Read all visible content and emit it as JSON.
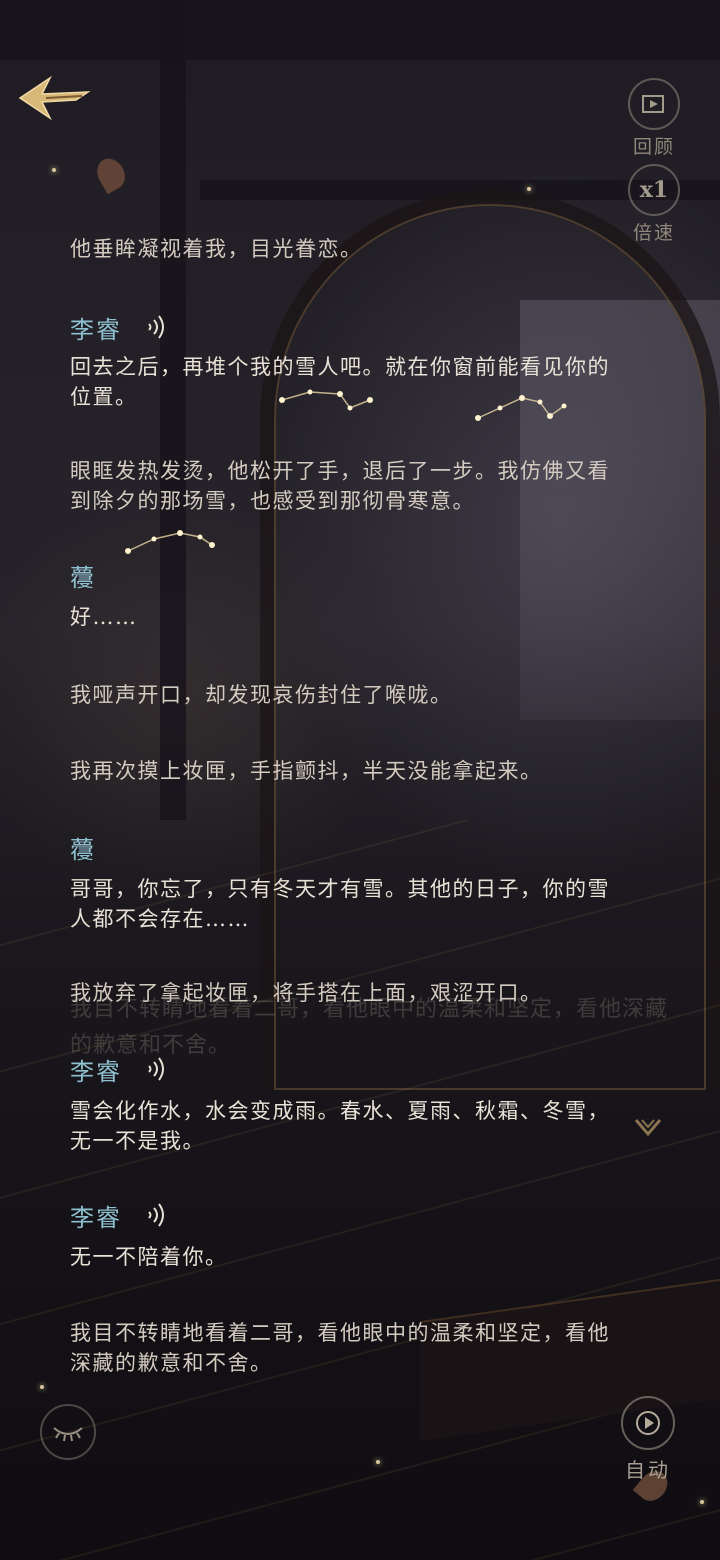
{
  "controls": {
    "back_icon": "back-arrow-icon",
    "review_label": "回顾",
    "speed_value": "x1",
    "speed_label": "倍速",
    "auto_label": "自动"
  },
  "dialogue": [
    {
      "type": "narration",
      "text": "他垂眸凝视着我，目光眷恋。"
    },
    {
      "type": "speech",
      "speaker": "李睿",
      "voice": true,
      "text": "回去之后，再堆个我的雪人吧。就在你窗前能看见你的位置。"
    },
    {
      "type": "narration",
      "text": "眼眶发热发烫，他松开了手，退后了一步。我仿佛又看到除夕的那场雪，也感受到那彻骨寒意。"
    },
    {
      "type": "speech",
      "speaker": "蘉",
      "voice": false,
      "text": "好……"
    },
    {
      "type": "narration",
      "text": "我哑声开口，却发现哀伤封住了喉咙。"
    },
    {
      "type": "narration",
      "text": "我再次摸上妆匣，手指颤抖，半天没能拿起来。"
    },
    {
      "type": "speech",
      "speaker": "蘉",
      "voice": false,
      "text": "哥哥，你忘了，只有冬天才有雪。其他的日子，你的雪人都不会存在……"
    },
    {
      "type": "narration",
      "text": "我放弃了拿起妆匣，将手搭在上面，艰涩开口。"
    },
    {
      "type": "speech",
      "speaker": "李睿",
      "voice": true,
      "text": "雪会化作水，水会变成雨。春水、夏雨、秋霜、冬雪，无一不是我。"
    },
    {
      "type": "speech",
      "speaker": "李睿",
      "voice": true,
      "text": "无一不陪着你。"
    },
    {
      "type": "narration",
      "text": "我目不转睛地看着二哥，看他眼中的温柔和坚定，看他深藏的歉意和不舍。"
    }
  ],
  "ghost_text": "我目不转睛地看着二哥，看他眼中的温柔和坚定，看他深藏的歉意和不舍。",
  "colors": {
    "speaker": "#8ec0cf",
    "text": "#e8e1d6",
    "accent_gold": "#d8b878"
  }
}
